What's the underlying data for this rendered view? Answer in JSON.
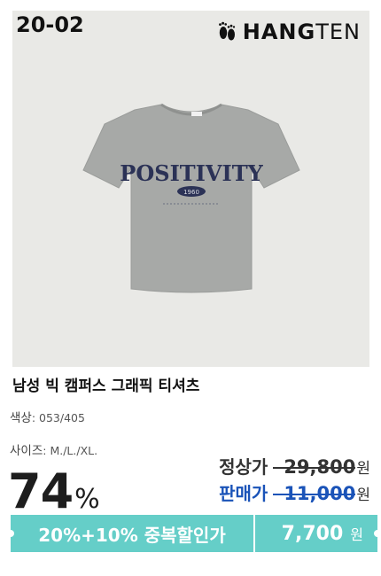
{
  "product_code": "20-02",
  "brand": {
    "name_bold": "HANG",
    "name_light": "TEN"
  },
  "shirt_print": {
    "text": "POSITIVITY",
    "year": "1960"
  },
  "title": "남성 빅 캠퍼스 그래픽 티셔츠",
  "color": {
    "label": "색상",
    "value": ": 053/405"
  },
  "size": {
    "label": "사이즈",
    "value": ": M./L./XL."
  },
  "discount": {
    "value": "74",
    "unit": "%"
  },
  "regular_price": {
    "label": "정상가",
    "value": "29,800",
    "unit": "원"
  },
  "sale_price": {
    "label": "판매가",
    "value": "11,000",
    "unit": "원"
  },
  "promo": {
    "text": "20%+10% 중복할인가",
    "price": "7,700",
    "unit": "원"
  },
  "colors": {
    "accent": "#65cec8",
    "sale_blue": "#1a53b8",
    "shirt_gray": "#a7a9a7",
    "print_navy": "#2b3256"
  }
}
